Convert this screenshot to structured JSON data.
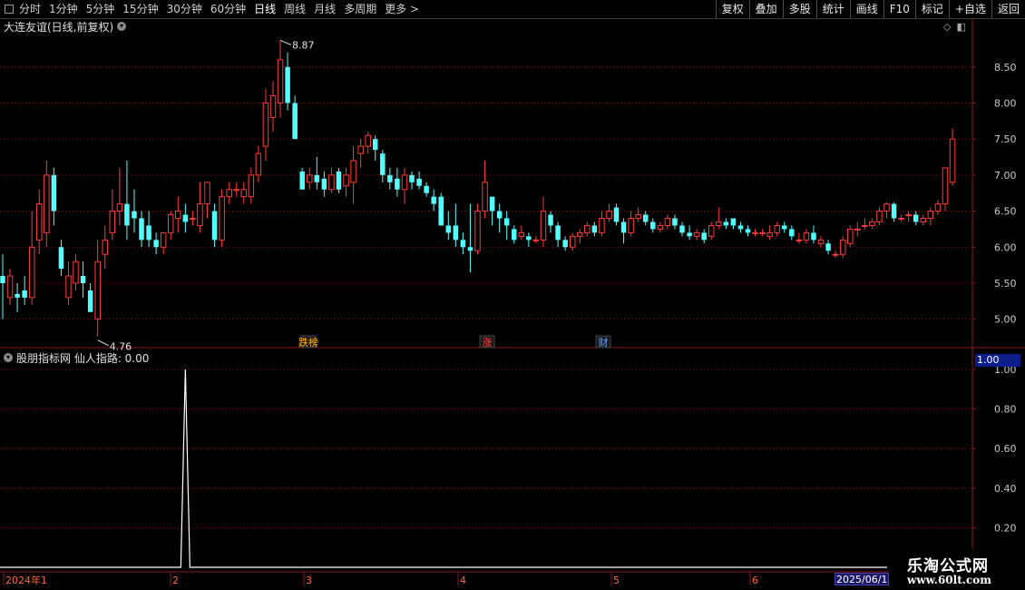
{
  "toolbar": {
    "periods": [
      "分时",
      "1分钟",
      "5分钟",
      "15分钟",
      "30分钟",
      "60分钟",
      "日线",
      "周线",
      "月线",
      "多周期",
      "更多 >"
    ],
    "active_period": "日线",
    "actions": [
      "复权",
      "叠加",
      "多股",
      "统计",
      "画线",
      "F10",
      "标记",
      "+自选",
      "返回"
    ]
  },
  "main_chart": {
    "title": "大连友谊(日线,前复权)",
    "high_label": "8.87",
    "low_label": "4.76",
    "price_ticks": [
      "8.50",
      "8.00",
      "7.50",
      "7.00",
      "6.50",
      "6.00",
      "5.50",
      "5.00"
    ],
    "markers": [
      "跌榜",
      "涨",
      "财"
    ]
  },
  "indicator": {
    "title": "股朋指标网 仙人指路: 0.00",
    "value_badge": "1.00",
    "ticks": [
      "1.00",
      "0.80",
      "0.60",
      "0.40",
      "0.20"
    ]
  },
  "x_axis": {
    "labels": [
      "2024年1",
      "2",
      "3",
      "4",
      "5",
      "6"
    ],
    "end_date": "2025/06/1"
  },
  "watermark": {
    "line1": "乐淘公式网",
    "line2": "www.60lt.com"
  },
  "colors": {
    "up": "#ff3b3b",
    "down": "#54ffff",
    "grid": "#7a1010",
    "axis": "#8a1a1a",
    "signal": "#ffffff"
  },
  "chart_data": [
    {
      "type": "candlestick",
      "title": "大连友谊(日线,前复权)",
      "y_range": [
        4.6,
        9.1
      ],
      "candles": [
        [
          5.6,
          5.5,
          5.9,
          5.0
        ],
        [
          5.3,
          5.6,
          5.7,
          5.2
        ],
        [
          5.35,
          5.3,
          5.5,
          5.1
        ],
        [
          5.4,
          5.3,
          5.6,
          5.2
        ],
        [
          5.3,
          6.0,
          6.5,
          5.2
        ],
        [
          6.1,
          6.6,
          6.8,
          5.9
        ],
        [
          6.2,
          7.0,
          7.2,
          6.0
        ],
        [
          7.0,
          6.5,
          7.1,
          6.3
        ],
        [
          6.0,
          5.7,
          6.1,
          5.6
        ],
        [
          5.3,
          5.6,
          5.8,
          5.2
        ],
        [
          5.5,
          5.8,
          5.9,
          5.4
        ],
        [
          5.6,
          5.5,
          5.8,
          5.3
        ],
        [
          5.4,
          5.1,
          5.5,
          5.1
        ],
        [
          5.0,
          5.8,
          6.1,
          4.76
        ],
        [
          5.9,
          6.1,
          6.3,
          5.7
        ],
        [
          6.2,
          6.5,
          6.8,
          6.1
        ],
        [
          6.5,
          6.6,
          7.1,
          6.3
        ],
        [
          6.6,
          6.3,
          7.2,
          6.1
        ],
        [
          6.5,
          6.4,
          6.8,
          6.2
        ],
        [
          6.4,
          6.1,
          6.5,
          6.0
        ],
        [
          6.3,
          6.1,
          6.5,
          6.0
        ],
        [
          6.1,
          6.0,
          6.2,
          5.9
        ],
        [
          6.0,
          6.2,
          6.2,
          5.9
        ],
        [
          6.2,
          6.45,
          6.5,
          6.1
        ],
        [
          6.4,
          6.5,
          6.7,
          6.2
        ],
        [
          6.45,
          6.35,
          6.6,
          6.2
        ],
        [
          6.4,
          6.4,
          6.5,
          6.3
        ],
        [
          6.3,
          6.6,
          6.9,
          6.2
        ],
        [
          6.6,
          6.9,
          6.9,
          6.4
        ],
        [
          6.5,
          6.1,
          6.6,
          6.0
        ],
        [
          6.1,
          6.7,
          6.8,
          6.0
        ],
        [
          6.7,
          6.8,
          6.9,
          6.6
        ],
        [
          6.8,
          6.8,
          6.9,
          6.7
        ],
        [
          6.7,
          6.8,
          6.9,
          6.6
        ],
        [
          6.7,
          7.0,
          7.1,
          6.6
        ],
        [
          7.0,
          7.3,
          7.4,
          6.9
        ],
        [
          7.4,
          8.0,
          8.2,
          7.2
        ],
        [
          7.8,
          8.1,
          8.3,
          7.6
        ],
        [
          8.0,
          8.6,
          8.87,
          7.8
        ],
        [
          8.5,
          8.0,
          8.7,
          7.9
        ],
        [
          8.0,
          7.5,
          8.1,
          7.5
        ],
        [
          7.05,
          6.8,
          7.1,
          6.8
        ],
        [
          6.9,
          7.0,
          7.1,
          6.8
        ],
        [
          7.0,
          6.9,
          7.25,
          6.8
        ],
        [
          6.95,
          6.8,
          7.05,
          6.7
        ],
        [
          6.8,
          7.0,
          7.1,
          6.75
        ],
        [
          7.05,
          6.8,
          7.1,
          6.75
        ],
        [
          6.85,
          7.0,
          7.1,
          6.7
        ],
        [
          6.9,
          7.2,
          7.4,
          6.6
        ],
        [
          7.3,
          7.4,
          7.5,
          7.1
        ],
        [
          7.4,
          7.55,
          7.6,
          7.3
        ],
        [
          7.5,
          7.35,
          7.55,
          7.2
        ],
        [
          7.3,
          7.0,
          7.35,
          6.9
        ],
        [
          7.0,
          6.9,
          7.1,
          6.8
        ],
        [
          6.95,
          6.8,
          7.1,
          6.7
        ],
        [
          6.8,
          7.0,
          7.1,
          6.6
        ],
        [
          7.0,
          6.9,
          7.05,
          6.8
        ],
        [
          6.95,
          6.85,
          7.05,
          6.8
        ],
        [
          6.85,
          6.75,
          6.9,
          6.7
        ],
        [
          6.7,
          6.6,
          6.8,
          6.5
        ],
        [
          6.7,
          6.3,
          6.75,
          6.3
        ],
        [
          6.3,
          6.2,
          6.5,
          6.1
        ],
        [
          6.3,
          6.1,
          6.6,
          6.0
        ],
        [
          6.1,
          6.0,
          6.2,
          5.9
        ],
        [
          6.0,
          5.95,
          6.6,
          5.65
        ],
        [
          5.95,
          6.5,
          6.6,
          5.9
        ],
        [
          6.5,
          6.9,
          7.2,
          6.4
        ],
        [
          6.7,
          6.5,
          6.7,
          6.3
        ],
        [
          6.5,
          6.4,
          6.6,
          6.2
        ],
        [
          6.4,
          6.3,
          6.5,
          6.1
        ],
        [
          6.25,
          6.1,
          6.3,
          6.05
        ],
        [
          6.15,
          6.2,
          6.3,
          6.1
        ],
        [
          6.15,
          6.1,
          6.2,
          6.0
        ],
        [
          6.1,
          6.1,
          6.15,
          6.05
        ],
        [
          6.1,
          6.5,
          6.7,
          6.0
        ],
        [
          6.45,
          6.3,
          6.5,
          6.2
        ],
        [
          6.3,
          6.1,
          6.35,
          6.0
        ],
        [
          6.1,
          6.0,
          6.15,
          5.95
        ],
        [
          6.0,
          6.15,
          6.2,
          5.95
        ],
        [
          6.15,
          6.2,
          6.25,
          6.05
        ],
        [
          6.2,
          6.3,
          6.35,
          6.15
        ],
        [
          6.3,
          6.2,
          6.35,
          6.15
        ],
        [
          6.2,
          6.4,
          6.5,
          6.15
        ],
        [
          6.4,
          6.5,
          6.6,
          6.35
        ],
        [
          6.55,
          6.35,
          6.6,
          6.3
        ],
        [
          6.35,
          6.2,
          6.4,
          6.05
        ],
        [
          6.2,
          6.4,
          6.5,
          6.15
        ],
        [
          6.4,
          6.45,
          6.55,
          6.35
        ],
        [
          6.45,
          6.35,
          6.5,
          6.3
        ],
        [
          6.35,
          6.25,
          6.4,
          6.2
        ],
        [
          6.25,
          6.3,
          6.35,
          6.2
        ],
        [
          6.3,
          6.4,
          6.45,
          6.25
        ],
        [
          6.4,
          6.3,
          6.45,
          6.25
        ],
        [
          6.3,
          6.2,
          6.35,
          6.15
        ],
        [
          6.2,
          6.15,
          6.3,
          6.1
        ],
        [
          6.15,
          6.2,
          6.25,
          6.1
        ],
        [
          6.2,
          6.1,
          6.25,
          6.05
        ],
        [
          6.15,
          6.3,
          6.35,
          6.1
        ],
        [
          6.3,
          6.35,
          6.55,
          6.25
        ],
        [
          6.35,
          6.3,
          6.4,
          6.25
        ],
        [
          6.4,
          6.3,
          6.4,
          6.25
        ],
        [
          6.3,
          6.25,
          6.35,
          6.2
        ],
        [
          6.25,
          6.2,
          6.3,
          6.15
        ],
        [
          6.2,
          6.2,
          6.25,
          6.15
        ],
        [
          6.2,
          6.2,
          6.25,
          6.15
        ],
        [
          6.15,
          6.2,
          6.3,
          6.1
        ],
        [
          6.2,
          6.3,
          6.35,
          6.15
        ],
        [
          6.3,
          6.25,
          6.35,
          6.2
        ],
        [
          6.25,
          6.15,
          6.3,
          6.1
        ],
        [
          6.1,
          6.1,
          6.2,
          6.05
        ],
        [
          6.1,
          6.2,
          6.25,
          6.05
        ],
        [
          6.2,
          6.1,
          6.3,
          6.05
        ],
        [
          6.05,
          6.1,
          6.15,
          6.0
        ],
        [
          6.05,
          5.95,
          6.1,
          5.9
        ],
        [
          5.9,
          5.9,
          5.95,
          5.85
        ],
        [
          5.9,
          6.1,
          6.15,
          5.85
        ],
        [
          6.05,
          6.25,
          6.3,
          6.0
        ],
        [
          6.25,
          6.25,
          6.35,
          6.15
        ],
        [
          6.3,
          6.3,
          6.4,
          6.25
        ],
        [
          6.3,
          6.35,
          6.4,
          6.25
        ],
        [
          6.35,
          6.5,
          6.55,
          6.3
        ],
        [
          6.5,
          6.6,
          6.62,
          6.4
        ],
        [
          6.6,
          6.4,
          6.62,
          6.35
        ],
        [
          6.4,
          6.4,
          6.45,
          6.35
        ],
        [
          6.45,
          6.45,
          6.5,
          6.35
        ],
        [
          6.45,
          6.35,
          6.5,
          6.3
        ],
        [
          6.35,
          6.4,
          6.45,
          6.3
        ],
        [
          6.4,
          6.5,
          6.55,
          6.3
        ],
        [
          6.5,
          6.6,
          6.65,
          6.45
        ],
        [
          6.6,
          7.1,
          7.1,
          6.5
        ],
        [
          6.9,
          7.5,
          7.65,
          6.85
        ]
      ]
    },
    {
      "type": "line",
      "title": "股朋指标网 仙人指路",
      "y_range": [
        0,
        1
      ],
      "series": [
        {
          "name": "仙人指路",
          "spike_index": 25,
          "values_note_last": 0.0
        }
      ]
    }
  ]
}
